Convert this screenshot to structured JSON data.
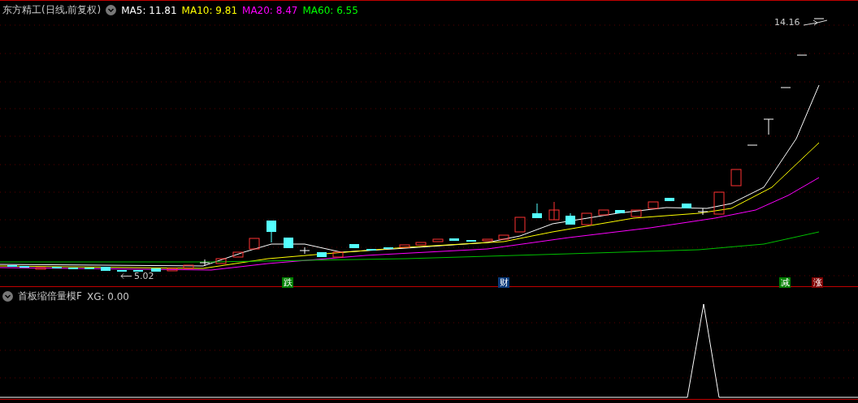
{
  "main_panel": {
    "title": "东方精工(日线,前复权)",
    "moving_averages": [
      {
        "text": "MA5: 11.81",
        "color": "#ffffff"
      },
      {
        "text": "MA10: 9.81",
        "color": "#ffff00"
      },
      {
        "text": "MA20: 8.47",
        "color": "#ff00ff"
      },
      {
        "text": "MA60: 6.55",
        "color": "#00ff00"
      }
    ],
    "high_label": "14.16",
    "low_label": "5.02",
    "event_markers": [
      {
        "text": "跌",
        "color": "#008000"
      },
      {
        "text": "财",
        "color": "#0a3a7a"
      },
      {
        "text": "减",
        "color": "#008000"
      },
      {
        "text": "涨",
        "color": "#800000"
      }
    ]
  },
  "indicator_panel": {
    "title": "首板缩倍量模F",
    "reading": "XG: 0.00"
  }
}
